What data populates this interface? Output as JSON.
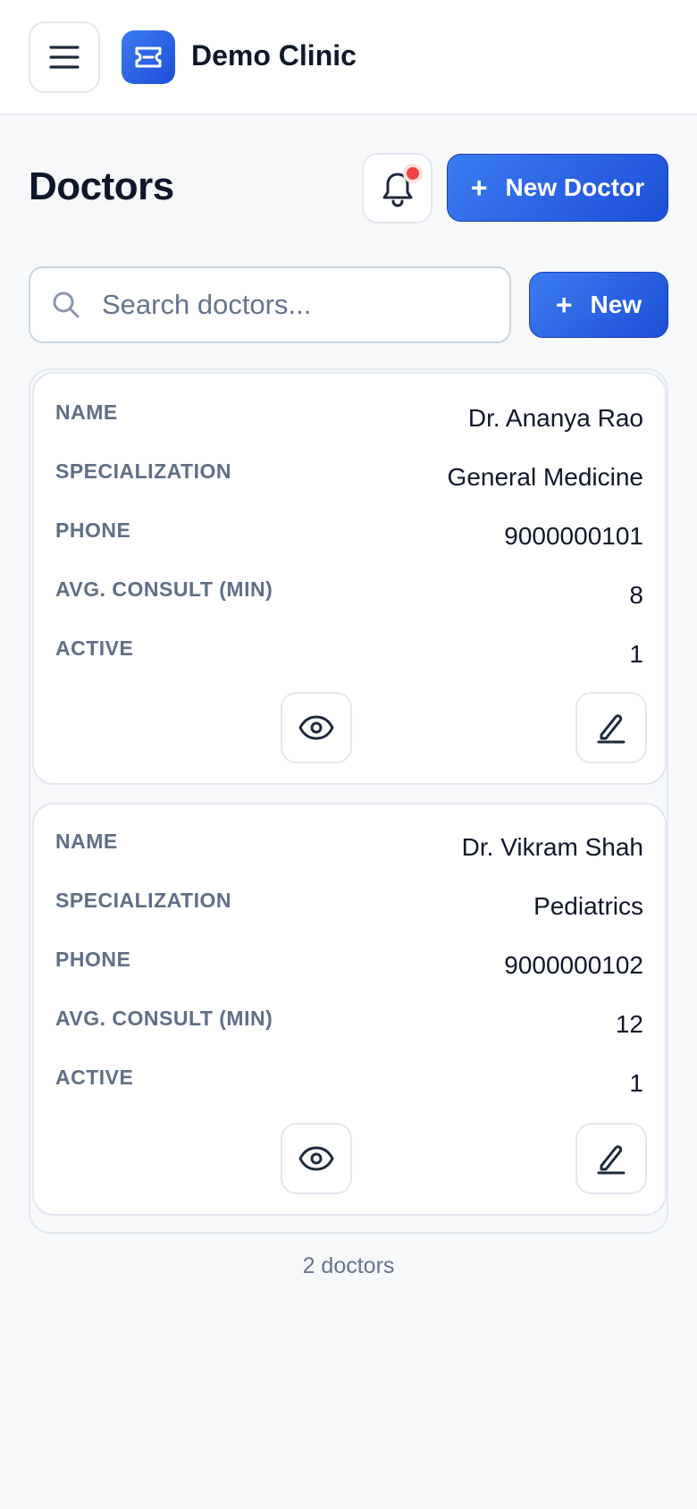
{
  "header": {
    "brand_name": "Demo Clinic",
    "menu_icon": "hamburger-menu-icon",
    "logo_icon": "ticket-icon"
  },
  "page": {
    "title": "Doctors",
    "new_doctor_label": "New Doctor",
    "new_label": "New",
    "accent_color": "#2563eb",
    "notification_dot_color": "#ef4444"
  },
  "search": {
    "placeholder": "Search doctors...",
    "value": ""
  },
  "doctors": [
    {
      "fields": [
        {
          "label": "NAME",
          "value": "Dr. Ananya Rao"
        },
        {
          "label": "SPECIALIZATION",
          "value": "General Medicine"
        },
        {
          "label": "PHONE",
          "value": "9000000101"
        },
        {
          "label": "AVG. CONSULT (MIN)",
          "value": "8"
        },
        {
          "label": "ACTIVE",
          "value": "1"
        }
      ]
    },
    {
      "fields": [
        {
          "label": "NAME",
          "value": "Dr. Vikram Shah"
        },
        {
          "label": "SPECIALIZATION",
          "value": "Pediatrics"
        },
        {
          "label": "PHONE",
          "value": "9000000102"
        },
        {
          "label": "AVG. CONSULT (MIN)",
          "value": "12"
        },
        {
          "label": "ACTIVE",
          "value": "1"
        }
      ]
    }
  ],
  "footer": {
    "count_text": "2 doctors"
  }
}
